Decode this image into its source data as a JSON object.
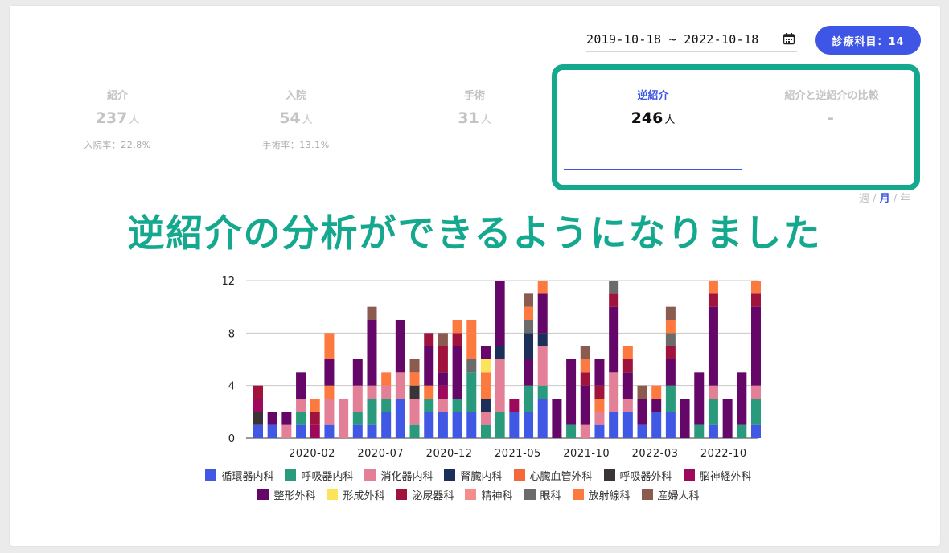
{
  "date_range": "2019-10-18 ~ 2022-10-18",
  "dept_button": "診療科目：14",
  "stats": [
    {
      "label": "紹介",
      "value": "237",
      "unit": "人",
      "sub": "入院率：22.8%"
    },
    {
      "label": "入院",
      "value": "54",
      "unit": "人",
      "sub": "手術率：13.1%"
    },
    {
      "label": "手術",
      "value": "31",
      "unit": "人",
      "sub": ""
    },
    {
      "label": "逆紹介",
      "value": "246",
      "unit": "人",
      "sub": ""
    },
    {
      "label": "紹介と逆紹介の比較",
      "value": "-",
      "unit": "",
      "sub": ""
    }
  ],
  "period": {
    "week": "週",
    "month": "月",
    "year": "年",
    "sep": "/"
  },
  "banner": "逆紹介の分析ができるようになりました",
  "colors": {
    "accent": "#3e55e6",
    "highlight": "#14a88e"
  },
  "chart_data": {
    "type": "bar",
    "stacked": true,
    "x_tick_labels": [
      "2020-02",
      "2020-07",
      "2020-12",
      "2021-05",
      "2021-10",
      "2022-03",
      "2022-10"
    ],
    "y_ticks": [
      0,
      4,
      8,
      12
    ],
    "ylim": [
      0,
      12
    ],
    "grid": true,
    "legend_position": "bottom",
    "series": [
      {
        "name": "循環器内科",
        "color": "#4058e3"
      },
      {
        "name": "呼吸器内科",
        "color": "#2a9a7c"
      },
      {
        "name": "消化器内科",
        "color": "#e47f98"
      },
      {
        "name": "腎臓内科",
        "color": "#1c2f58"
      },
      {
        "name": "心臓血管外科",
        "color": "#f4683a"
      },
      {
        "name": "呼吸器外科",
        "color": "#3a3437"
      },
      {
        "name": "脳神経外科",
        "color": "#9e0a5b"
      },
      {
        "name": "整形外科",
        "color": "#650768"
      },
      {
        "name": "形成外科",
        "color": "#fbe35a"
      },
      {
        "name": "泌尿器科",
        "color": "#a0133c"
      },
      {
        "name": "精神科",
        "color": "#f58c8c"
      },
      {
        "name": "眼科",
        "color": "#6b6b6b"
      },
      {
        "name": "放射線科",
        "color": "#fc7a3f"
      },
      {
        "name": "産婦人科",
        "color": "#8a5b4e"
      }
    ],
    "bars": [
      [
        [
          0,
          1
        ],
        [
          5,
          1
        ],
        [
          6,
          1
        ],
        [
          9,
          1
        ]
      ],
      [
        [
          0,
          1
        ],
        [
          7,
          1
        ]
      ],
      [
        [
          2,
          1
        ],
        [
          7,
          1
        ]
      ],
      [
        [
          0,
          1
        ],
        [
          1,
          1
        ],
        [
          2,
          1
        ],
        [
          7,
          2
        ]
      ],
      [
        [
          6,
          1
        ],
        [
          9,
          1
        ],
        [
          12,
          1
        ]
      ],
      [
        [
          0,
          1
        ],
        [
          2,
          2
        ],
        [
          12,
          1
        ],
        [
          7,
          2
        ],
        [
          12,
          2
        ]
      ],
      [
        [
          2,
          3
        ]
      ],
      [
        [
          0,
          1
        ],
        [
          1,
          1
        ],
        [
          2,
          2
        ],
        [
          7,
          2
        ]
      ],
      [
        [
          0,
          1
        ],
        [
          1,
          2
        ],
        [
          2,
          1
        ],
        [
          7,
          5
        ],
        [
          13,
          1
        ]
      ],
      [
        [
          0,
          2
        ],
        [
          1,
          1
        ],
        [
          2,
          1
        ],
        [
          12,
          1
        ]
      ],
      [
        [
          0,
          3
        ],
        [
          2,
          2
        ],
        [
          7,
          1
        ],
        [
          7,
          3
        ]
      ],
      [
        [
          1,
          1
        ],
        [
          2,
          2
        ],
        [
          5,
          1
        ],
        [
          12,
          1
        ],
        [
          13,
          1
        ]
      ],
      [
        [
          0,
          2
        ],
        [
          1,
          1
        ],
        [
          12,
          1
        ],
        [
          7,
          3
        ],
        [
          9,
          1
        ]
      ],
      [
        [
          0,
          2
        ],
        [
          2,
          1
        ],
        [
          6,
          1
        ],
        [
          7,
          1
        ],
        [
          9,
          2
        ],
        [
          13,
          1
        ]
      ],
      [
        [
          0,
          2
        ],
        [
          1,
          1
        ],
        [
          7,
          4
        ],
        [
          9,
          1
        ],
        [
          12,
          1
        ]
      ],
      [
        [
          0,
          2
        ],
        [
          1,
          3
        ],
        [
          11,
          1
        ],
        [
          12,
          2
        ],
        [
          12,
          1
        ]
      ],
      [
        [
          1,
          1
        ],
        [
          2,
          1
        ],
        [
          3,
          1
        ],
        [
          12,
          2
        ],
        [
          8,
          1
        ],
        [
          7,
          1
        ]
      ],
      [
        [
          1,
          2
        ],
        [
          2,
          4
        ],
        [
          3,
          1
        ],
        [
          7,
          5
        ]
      ],
      [
        [
          0,
          2
        ],
        [
          6,
          1
        ]
      ],
      [
        [
          0,
          2
        ],
        [
          1,
          2
        ],
        [
          7,
          2
        ],
        [
          3,
          2
        ],
        [
          11,
          1
        ],
        [
          12,
          1
        ],
        [
          13,
          1
        ]
      ],
      [
        [
          0,
          3
        ],
        [
          1,
          1
        ],
        [
          2,
          3
        ],
        [
          3,
          1
        ],
        [
          7,
          3
        ],
        [
          12,
          1
        ]
      ],
      [
        [
          7,
          3
        ]
      ],
      [
        [
          1,
          1
        ],
        [
          7,
          5
        ]
      ],
      [
        [
          2,
          1
        ],
        [
          7,
          3
        ],
        [
          9,
          1
        ],
        [
          12,
          1
        ],
        [
          13,
          1
        ]
      ],
      [
        [
          0,
          1
        ],
        [
          2,
          1
        ],
        [
          12,
          1
        ],
        [
          9,
          1
        ],
        [
          7,
          2
        ]
      ],
      [
        [
          0,
          2
        ],
        [
          2,
          3
        ],
        [
          7,
          5
        ],
        [
          9,
          1
        ],
        [
          11,
          1
        ]
      ],
      [
        [
          0,
          2
        ],
        [
          2,
          1
        ],
        [
          7,
          2
        ],
        [
          9,
          1
        ],
        [
          12,
          1
        ]
      ],
      [
        [
          0,
          1
        ],
        [
          7,
          2
        ],
        [
          13,
          1
        ]
      ],
      [
        [
          0,
          2
        ],
        [
          7,
          1
        ],
        [
          12,
          1
        ]
      ],
      [
        [
          0,
          2
        ],
        [
          1,
          2
        ],
        [
          7,
          2
        ],
        [
          9,
          1
        ],
        [
          11,
          1
        ],
        [
          12,
          1
        ],
        [
          13,
          1
        ]
      ],
      [
        [
          7,
          3
        ]
      ],
      [
        [
          1,
          1
        ],
        [
          7,
          4
        ]
      ],
      [
        [
          0,
          1
        ],
        [
          1,
          2
        ],
        [
          2,
          1
        ],
        [
          7,
          6
        ],
        [
          9,
          1
        ],
        [
          12,
          1
        ]
      ],
      [
        [
          7,
          3
        ]
      ],
      [
        [
          1,
          1
        ],
        [
          7,
          4
        ]
      ],
      [
        [
          0,
          1
        ],
        [
          1,
          2
        ],
        [
          2,
          1
        ],
        [
          7,
          6
        ],
        [
          9,
          1
        ],
        [
          12,
          1
        ]
      ]
    ]
  }
}
